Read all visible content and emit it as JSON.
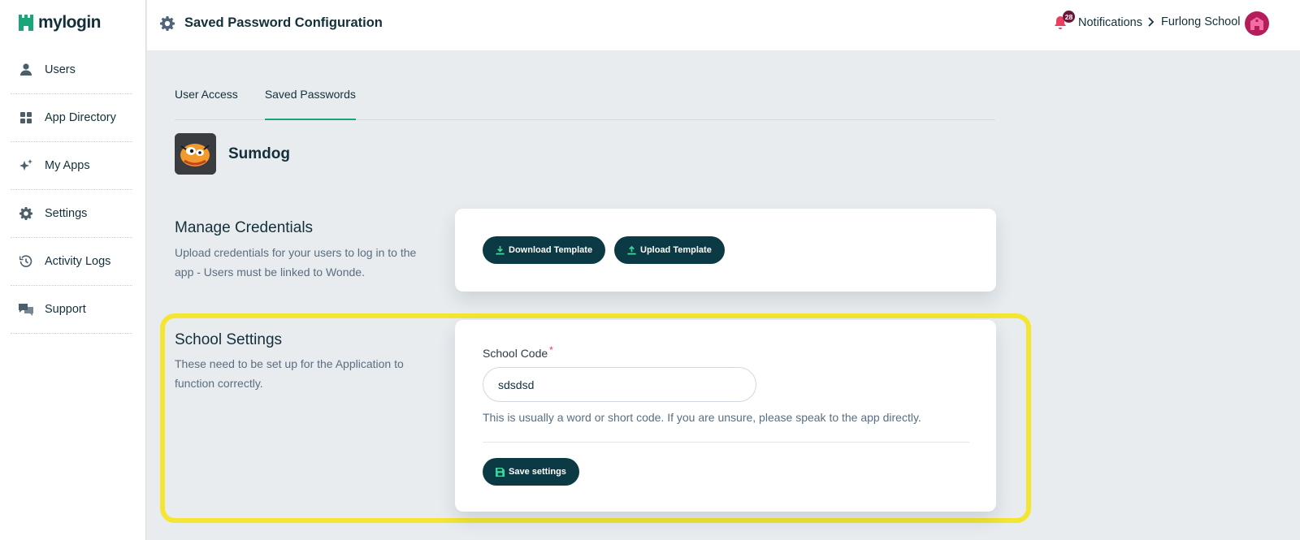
{
  "brand": {
    "name": "mylogin",
    "color": "#1aa57a"
  },
  "sidebar": {
    "items": [
      {
        "label": "Users",
        "icon": "user-icon"
      },
      {
        "label": "App Directory",
        "icon": "grid-icon"
      },
      {
        "label": "My Apps",
        "icon": "sparkle-icon"
      },
      {
        "label": "Settings",
        "icon": "gear-icon"
      },
      {
        "label": "Activity Logs",
        "icon": "history-icon"
      },
      {
        "label": "Support",
        "icon": "chat-icon"
      }
    ]
  },
  "header": {
    "title": "Saved Password Configuration",
    "notifications": {
      "label": "Notifications",
      "count": "28"
    },
    "school": {
      "label": "Furlong School"
    }
  },
  "tabs": [
    {
      "label": "User Access",
      "active": false
    },
    {
      "label": "Saved Passwords",
      "active": true
    }
  ],
  "app": {
    "name": "Sumdog"
  },
  "manage_credentials": {
    "title": "Manage Credentials",
    "description": "Upload credentials for your users to log in to the app - Users must be linked to Wonde.",
    "download_label": "Download Template",
    "upload_label": "Upload Template"
  },
  "school_settings": {
    "title": "School Settings",
    "description": "These need to be set up for the Application to function correctly.",
    "field_label": "School Code",
    "required_marker": "*",
    "field_value": "sdsdsd",
    "help_text": "This is usually a word or short code. If you are unsure, please speak to the app directly.",
    "save_label": "Save settings"
  },
  "colors": {
    "accent": "#1aa57a",
    "button_bg": "#0c3a44",
    "highlight": "#f3e532",
    "notification": "#e9405f"
  }
}
